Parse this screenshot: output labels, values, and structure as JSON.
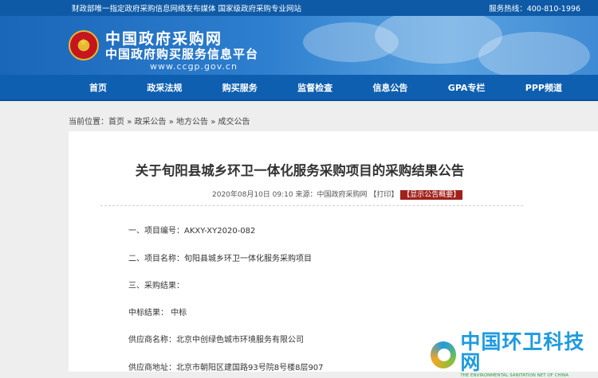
{
  "topbar": {
    "left": "财政部唯一指定政府采购信息网络发布媒体 国家级政府采购专业网站",
    "right": "服务热线：400-810-1996"
  },
  "banner": {
    "title": "中国政府采购网",
    "subtitle": "中国政府购买服务信息平台",
    "url": "www.ccgp.gov.cn"
  },
  "nav": [
    "首页",
    "政采法规",
    "购买服务",
    "监督检查",
    "信息公告",
    "GPA专栏",
    "PPP频道"
  ],
  "breadcrumb": {
    "prefix": "当前位置：",
    "items": [
      "首页",
      "政采公告",
      "地方公告",
      "成交公告"
    ],
    "sep": "»"
  },
  "article": {
    "title": "关于旬阳县城乡环卫一体化服务采购项目的采购结果公告",
    "meta": "2020年08月10日 09:10 来源：中国政府采购网 【打印】",
    "badge": "【显示公告概要】",
    "lines": [
      "一、项目编号：AKXY-XY2020-082",
      "二、项目名称：旬阳县城乡环卫一体化服务采购项目",
      "三、采购结果：",
      "中标结果：  中标",
      "供应商名称：北京中创绿色城市环境服务有限公司",
      "供应商地址：北京市朝阳区建国路93号院8号楼8层907"
    ]
  },
  "watermark": {
    "cn": "中国环卫科技网",
    "en": "THE ENVIRONMENTAL SANITATION NET OF CHINA"
  },
  "colors": {
    "brand_blue": "#0f5fb0",
    "badge_red": "#a0211c"
  }
}
